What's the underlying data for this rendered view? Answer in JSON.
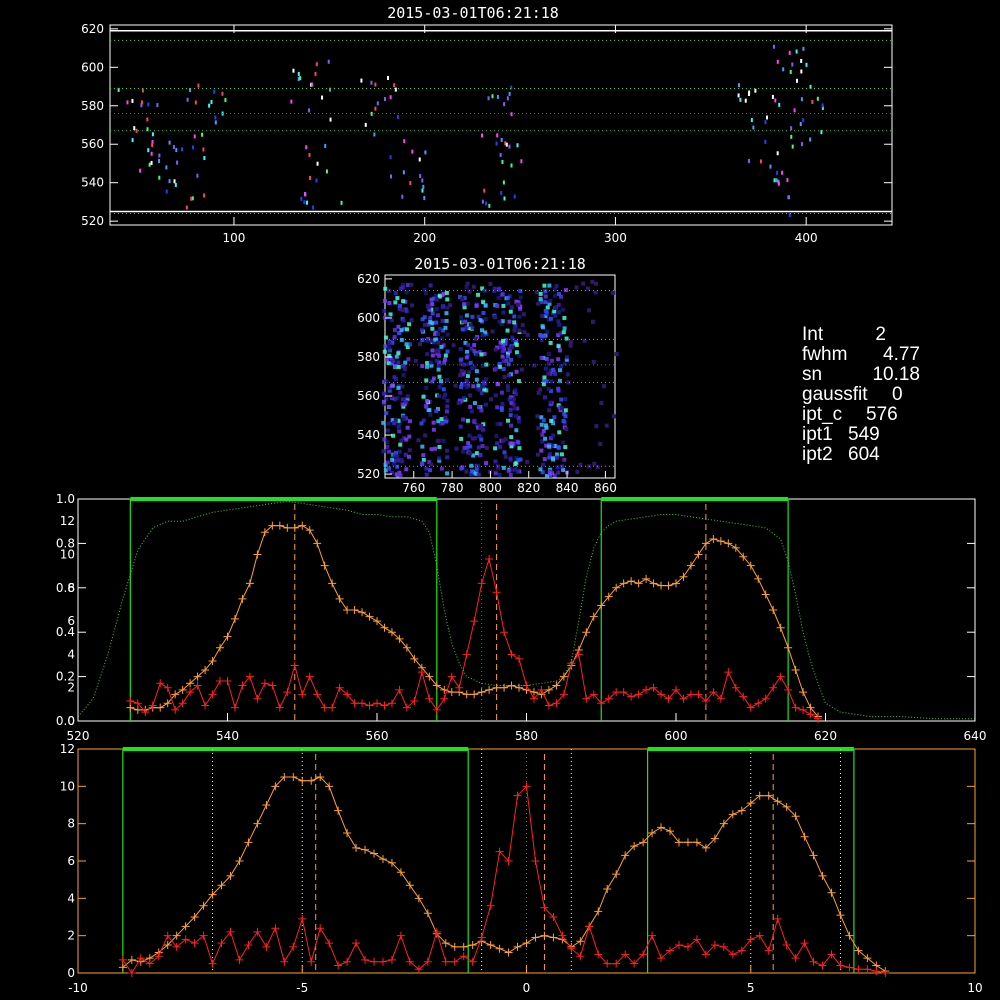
{
  "colors": {
    "background": "#000000",
    "axis": "#ffffff",
    "orange": "#ffa030",
    "red": "#ff2020",
    "green": "#20e020",
    "green_dotted": "#40d040",
    "yellow_dotted": "#ffff80",
    "red_axis": "#ff6040"
  },
  "top_map": {
    "title": "2015-03-01T06:21:18"
  },
  "small_map": {
    "title": "2015-03-01T06:21:18"
  },
  "info": {
    "lines": [
      {
        "key": "Int",
        "value": "2"
      },
      {
        "key": "fwhm",
        "value": "4.77"
      },
      {
        "key": "sn",
        "value": "10.18"
      },
      {
        "key": "gaussfit",
        "value": "0"
      },
      {
        "key": "ipt_c",
        "value": "576"
      },
      {
        "key": "ipt1",
        "value": "549"
      },
      {
        "key": "ipt2",
        "value": "604"
      }
    ]
  },
  "chart_data": [
    {
      "type": "heatmap",
      "title": "2015-03-01T06:21:18",
      "xlim": [
        35,
        445
      ],
      "ylim": [
        518,
        622
      ],
      "xticks": [
        100,
        200,
        300,
        400
      ],
      "yticks": [
        520,
        540,
        560,
        580,
        600,
        620
      ],
      "hlines_dotted_green": [
        524,
        567,
        589,
        614
      ],
      "hlines_solid_white": [
        525,
        619
      ],
      "hline_dotted_red": 576,
      "pixel_clusters": [
        [
          50,
          575
        ],
        [
          60,
          555
        ],
        [
          75,
          545
        ],
        [
          85,
          575
        ],
        [
          140,
          590
        ],
        [
          145,
          545
        ],
        [
          175,
          580
        ],
        [
          190,
          550
        ],
        [
          235,
          575
        ],
        [
          240,
          545
        ],
        [
          375,
          575
        ],
        [
          390,
          600
        ],
        [
          400,
          575
        ],
        [
          380,
          540
        ]
      ]
    },
    {
      "type": "heatmap",
      "title": "2015-03-01T06:21:18",
      "xlim": [
        745,
        865
      ],
      "ylim": [
        518,
        622
      ],
      "xticks": [
        760,
        780,
        800,
        820,
        840,
        860
      ],
      "yticks": [
        520,
        540,
        560,
        580,
        600,
        620
      ],
      "hlines_dotted_green": [
        524,
        567,
        589,
        614
      ],
      "hline_dotted_red": 576,
      "columns": [
        750,
        770,
        790,
        808,
        832
      ]
    },
    {
      "type": "line",
      "xlim": [
        520,
        640
      ],
      "xticks": [
        520,
        540,
        560,
        580,
        600,
        620,
        640
      ],
      "yticks_left": [
        "0.0",
        "0.2",
        "0.4",
        "0.6",
        "0.8",
        "1.0"
      ],
      "yticks_red": [
        "0",
        "2",
        "4",
        "6",
        "8",
        "10",
        "12"
      ],
      "ylim": [
        0,
        1.0
      ],
      "series": [
        {
          "name": "",
          "color": "orange",
          "x": [
            527,
            528,
            529,
            530,
            531,
            532,
            533,
            534,
            535,
            536,
            537,
            538,
            539,
            540,
            541,
            542,
            543,
            544,
            545,
            546,
            547,
            548,
            549,
            550,
            551,
            552,
            553,
            554,
            555,
            556,
            557,
            558,
            559,
            560,
            561,
            562,
            563,
            564,
            565,
            566,
            567,
            568,
            569,
            570,
            571,
            572,
            573,
            574,
            575,
            576,
            577,
            578,
            579,
            580,
            581,
            582,
            583,
            584,
            585,
            586,
            587,
            588,
            589,
            590,
            591,
            592,
            593,
            594,
            595,
            596,
            597,
            598,
            599,
            600,
            601,
            602,
            603,
            604,
            605,
            606,
            607,
            608,
            609,
            610,
            611,
            612,
            613,
            614,
            615,
            616,
            617,
            618,
            619
          ],
          "values": [
            0.06,
            0.05,
            0.05,
            0.06,
            0.06,
            0.08,
            0.12,
            0.14,
            0.17,
            0.2,
            0.23,
            0.27,
            0.33,
            0.38,
            0.46,
            0.55,
            0.62,
            0.75,
            0.85,
            0.88,
            0.88,
            0.87,
            0.87,
            0.88,
            0.86,
            0.8,
            0.7,
            0.62,
            0.55,
            0.5,
            0.5,
            0.49,
            0.47,
            0.45,
            0.42,
            0.4,
            0.37,
            0.33,
            0.28,
            0.24,
            0.2,
            0.16,
            0.14,
            0.13,
            0.13,
            0.12,
            0.12,
            0.13,
            0.14,
            0.15,
            0.15,
            0.16,
            0.15,
            0.14,
            0.13,
            0.12,
            0.14,
            0.16,
            0.2,
            0.25,
            0.32,
            0.4,
            0.47,
            0.52,
            0.56,
            0.6,
            0.62,
            0.63,
            0.62,
            0.64,
            0.62,
            0.61,
            0.61,
            0.62,
            0.65,
            0.7,
            0.75,
            0.8,
            0.82,
            0.81,
            0.8,
            0.78,
            0.74,
            0.7,
            0.64,
            0.57,
            0.5,
            0.42,
            0.33,
            0.23,
            0.13,
            0.06,
            0.02
          ]
        },
        {
          "name": "",
          "color": "red",
          "x": [
            527,
            528,
            529,
            530,
            531,
            532,
            533,
            534,
            535,
            536,
            537,
            538,
            539,
            540,
            541,
            542,
            543,
            544,
            545,
            546,
            547,
            548,
            549,
            550,
            551,
            552,
            553,
            554,
            555,
            556,
            557,
            558,
            559,
            560,
            561,
            562,
            563,
            564,
            565,
            566,
            567,
            568,
            569,
            570,
            571,
            572,
            573,
            574,
            575,
            576,
            577,
            578,
            579,
            580,
            581,
            582,
            583,
            584,
            585,
            586,
            587,
            588,
            589,
            590,
            591,
            592,
            593,
            594,
            595,
            596,
            597,
            598,
            599,
            600,
            601,
            602,
            603,
            604,
            605,
            606,
            607,
            608,
            609,
            610,
            611,
            612,
            613,
            614,
            615,
            616,
            617,
            618,
            619
          ],
          "values": [
            0.09,
            0.08,
            0.04,
            0.07,
            0.17,
            0.15,
            0.05,
            0.08,
            0.13,
            0.16,
            0.07,
            0.12,
            0.18,
            0.18,
            0.06,
            0.16,
            0.2,
            0.1,
            0.17,
            0.16,
            0.06,
            0.13,
            0.25,
            0.12,
            0.2,
            0.12,
            0.06,
            0.06,
            0.15,
            0.12,
            0.08,
            0.08,
            0.07,
            0.08,
            0.07,
            0.08,
            0.14,
            0.06,
            0.09,
            0.22,
            0.1,
            0.05,
            0.1,
            0.2,
            0.15,
            0.3,
            0.45,
            0.62,
            0.73,
            0.58,
            0.4,
            0.3,
            0.28,
            0.16,
            0.1,
            0.14,
            0.07,
            0.08,
            0.12,
            0.26,
            0.3,
            0.1,
            0.12,
            0.08,
            0.1,
            0.13,
            0.13,
            0.11,
            0.12,
            0.14,
            0.15,
            0.12,
            0.1,
            0.14,
            0.1,
            0.12,
            0.12,
            0.09,
            0.13,
            0.1,
            0.22,
            0.15,
            0.11,
            0.06,
            0.08,
            0.1,
            0.15,
            0.2,
            0.14,
            0.06,
            0.05,
            0.03,
            0.01
          ]
        },
        {
          "name": "",
          "color": "green_dotted",
          "x": [
            520,
            522,
            524,
            526,
            528,
            530,
            532,
            534,
            536,
            538,
            540,
            542,
            544,
            546,
            548,
            550,
            552,
            554,
            556,
            558,
            560,
            562,
            564,
            566,
            567,
            568,
            569,
            570,
            571,
            572,
            574,
            576,
            578,
            580,
            582,
            584,
            585,
            586,
            587,
            588,
            589,
            590,
            591,
            592,
            594,
            596,
            598,
            600,
            602,
            604,
            606,
            608,
            610,
            612,
            614,
            615,
            616,
            617,
            618,
            619,
            620,
            622,
            624,
            626,
            630,
            635,
            640
          ],
          "values": [
            0.02,
            0.1,
            0.3,
            0.55,
            0.77,
            0.87,
            0.9,
            0.9,
            0.92,
            0.94,
            0.95,
            0.96,
            0.97,
            0.98,
            0.99,
            0.98,
            0.97,
            0.96,
            0.95,
            0.93,
            0.93,
            0.92,
            0.92,
            0.9,
            0.85,
            0.7,
            0.5,
            0.35,
            0.26,
            0.2,
            0.17,
            0.16,
            0.16,
            0.16,
            0.17,
            0.18,
            0.2,
            0.27,
            0.45,
            0.65,
            0.78,
            0.85,
            0.88,
            0.9,
            0.91,
            0.92,
            0.93,
            0.93,
            0.92,
            0.91,
            0.9,
            0.89,
            0.88,
            0.87,
            0.82,
            0.72,
            0.57,
            0.4,
            0.27,
            0.17,
            0.08,
            0.04,
            0.03,
            0.02,
            0.02,
            0.01,
            0.01
          ]
        }
      ],
      "vlines_green": [
        527,
        568,
        590,
        615
      ],
      "vlines_dashed_orange": [
        549,
        576,
        604
      ],
      "vline_dotted_red": 574
    },
    {
      "type": "line",
      "xlim": [
        -10,
        10
      ],
      "xticks": [
        -10,
        -5,
        0,
        5,
        10
      ],
      "yticks_left": [
        "0",
        "2",
        "4",
        "6",
        "8",
        "10",
        "12"
      ],
      "ylim": [
        0,
        12
      ],
      "series": [
        {
          "name": "",
          "color": "orange",
          "x": [
            -9.0,
            -8.8,
            -8.6,
            -8.4,
            -8.2,
            -8.0,
            -7.8,
            -7.6,
            -7.4,
            -7.2,
            -7.0,
            -6.8,
            -6.6,
            -6.4,
            -6.2,
            -6.0,
            -5.8,
            -5.6,
            -5.4,
            -5.2,
            -5.0,
            -4.8,
            -4.6,
            -4.4,
            -4.2,
            -4.0,
            -3.8,
            -3.6,
            -3.4,
            -3.2,
            -3.0,
            -2.8,
            -2.6,
            -2.4,
            -2.2,
            -2.0,
            -1.8,
            -1.6,
            -1.4,
            -1.2,
            -1.0,
            -0.8,
            -0.6,
            -0.4,
            -0.2,
            0.0,
            0.2,
            0.4,
            0.6,
            0.8,
            1.0,
            1.2,
            1.4,
            1.6,
            1.8,
            2.0,
            2.2,
            2.4,
            2.6,
            2.8,
            3.0,
            3.2,
            3.4,
            3.6,
            3.8,
            4.0,
            4.2,
            4.4,
            4.6,
            4.8,
            5.0,
            5.2,
            5.4,
            5.6,
            5.8,
            6.0,
            6.2,
            6.4,
            6.6,
            6.8,
            7.0,
            7.2,
            7.4,
            7.6,
            7.8,
            8.0
          ],
          "values": [
            0.3,
            0.7,
            0.6,
            0.8,
            1.1,
            1.5,
            2.0,
            2.5,
            3.0,
            3.6,
            4.2,
            4.7,
            5.2,
            6.0,
            7.0,
            8.0,
            9.0,
            10.0,
            10.5,
            10.5,
            10.3,
            10.3,
            10.5,
            10.0,
            8.7,
            7.5,
            6.7,
            6.6,
            6.4,
            6.1,
            5.9,
            5.4,
            4.7,
            4.0,
            3.2,
            2.1,
            1.6,
            1.4,
            1.4,
            1.5,
            1.7,
            1.5,
            1.3,
            1.1,
            1.4,
            1.6,
            1.9,
            2.0,
            1.9,
            1.8,
            1.4,
            1.7,
            2.5,
            3.3,
            4.5,
            5.3,
            6.3,
            6.8,
            7.0,
            7.5,
            7.8,
            7.6,
            7.0,
            7.0,
            7.0,
            6.7,
            7.2,
            8.0,
            8.5,
            8.7,
            9.1,
            9.5,
            9.5,
            9.2,
            8.9,
            8.4,
            7.3,
            6.3,
            5.2,
            4.3,
            3.1,
            2.0,
            1.2,
            0.8,
            0.4,
            0.1
          ]
        },
        {
          "name": "",
          "color": "red",
          "x": [
            -9.0,
            -8.8,
            -8.6,
            -8.4,
            -8.2,
            -8.0,
            -7.8,
            -7.6,
            -7.4,
            -7.2,
            -7.0,
            -6.8,
            -6.6,
            -6.4,
            -6.2,
            -6.0,
            -5.8,
            -5.6,
            -5.4,
            -5.2,
            -5.0,
            -4.8,
            -4.6,
            -4.4,
            -4.2,
            -4.0,
            -3.8,
            -3.6,
            -3.4,
            -3.2,
            -3.0,
            -2.8,
            -2.6,
            -2.4,
            -2.2,
            -2.0,
            -1.8,
            -1.6,
            -1.4,
            -1.2,
            -1.0,
            -0.8,
            -0.6,
            -0.4,
            -0.2,
            0.0,
            0.2,
            0.4,
            0.6,
            0.8,
            1.0,
            1.2,
            1.4,
            1.6,
            1.8,
            2.0,
            2.2,
            2.4,
            2.6,
            2.8,
            3.0,
            3.2,
            3.4,
            3.6,
            3.8,
            4.0,
            4.2,
            4.4,
            4.6,
            4.8,
            5.0,
            5.2,
            5.4,
            5.6,
            5.8,
            6.0,
            6.2,
            6.4,
            6.6,
            6.8,
            7.0,
            7.2,
            7.4,
            7.6,
            7.8,
            8.0
          ],
          "values": [
            0.7,
            0.0,
            0.8,
            0.5,
            0.9,
            2.0,
            1.4,
            1.8,
            1.6,
            2.0,
            0.5,
            1.6,
            2.2,
            0.7,
            1.5,
            2.2,
            1.4,
            2.4,
            0.6,
            1.4,
            2.9,
            0.6,
            2.4,
            1.6,
            0.4,
            0.6,
            1.6,
            0.7,
            0.6,
            0.6,
            0.7,
            2.0,
            0.6,
            0.2,
            0.6,
            2.2,
            0.6,
            0.6,
            0.9,
            0.6,
            1.9,
            3.6,
            6.5,
            6.0,
            9.5,
            10.0,
            6.0,
            3.5,
            3.0,
            2.0,
            1.3,
            0.9,
            2.5,
            1.0,
            0.5,
            0.5,
            1.0,
            0.5,
            1.0,
            2.0,
            0.8,
            1.2,
            1.5,
            1.4,
            1.8,
            1.0,
            1.5,
            1.4,
            1.0,
            1.2,
            1.8,
            2.0,
            1.2,
            2.9,
            1.5,
            0.8,
            1.6,
            0.6,
            0.4,
            1.0,
            0.4,
            0.3,
            0.2,
            0.2,
            0.1,
            0.0
          ]
        }
      ],
      "vlines_green": [
        -9.0,
        -1.3,
        2.7,
        7.3
      ],
      "vlines_dashed_orange": [
        -4.7,
        0.4,
        5.5
      ],
      "vlines_dotted_white": [
        -7.0,
        -5.0,
        -1.0,
        1.0,
        5.0,
        7.0
      ],
      "vline_dotted_red": 0.0
    }
  ]
}
